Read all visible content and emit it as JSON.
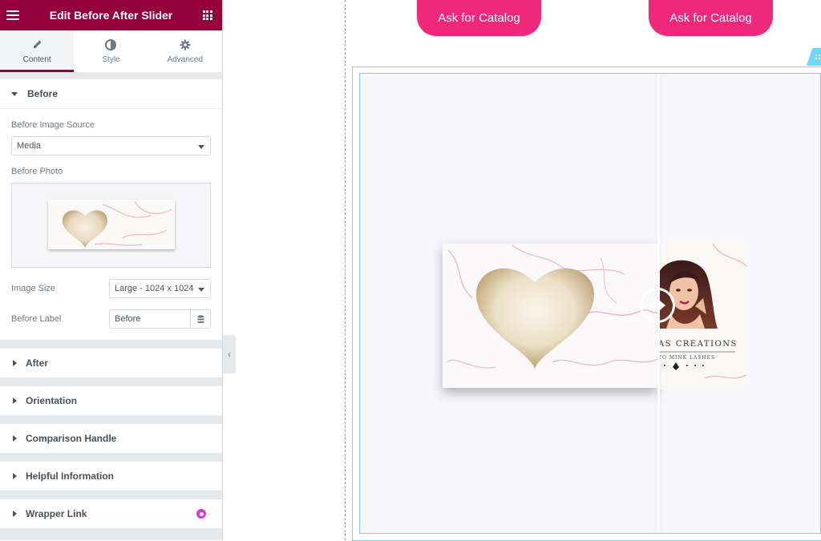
{
  "panel": {
    "title": "Edit Before After Slider",
    "tabs": [
      {
        "label": "Content",
        "icon": "pencil-icon",
        "active": true
      },
      {
        "label": "Style",
        "icon": "half-circle-icon",
        "active": false
      },
      {
        "label": "Advanced",
        "icon": "gear-icon",
        "active": false
      }
    ],
    "before_section": {
      "title": "Before",
      "image_source_label": "Before Image Source",
      "image_source_value": "Media",
      "photo_label": "Before Photo",
      "image_size_label": "Image Size",
      "image_size_value": "Large - 1024 x 1024",
      "before_label_label": "Before Label",
      "before_label_value": "Before"
    },
    "sections": [
      {
        "title": "After"
      },
      {
        "title": "Orientation"
      },
      {
        "title": "Comparison Handle"
      },
      {
        "title": "Helpful Information"
      },
      {
        "title": "Wrapper Link"
      }
    ],
    "accent_color": "#93003c"
  },
  "canvas": {
    "cta_buttons": [
      {
        "label": "Ask for Catalog"
      },
      {
        "label": "Ask for Catalog"
      }
    ],
    "cta_color": "#f0287c",
    "frame_color": "#71d7f7",
    "after_card_text": {
      "brand": "AS CREATIONS",
      "tagline": "TO MINK LASHES"
    }
  }
}
